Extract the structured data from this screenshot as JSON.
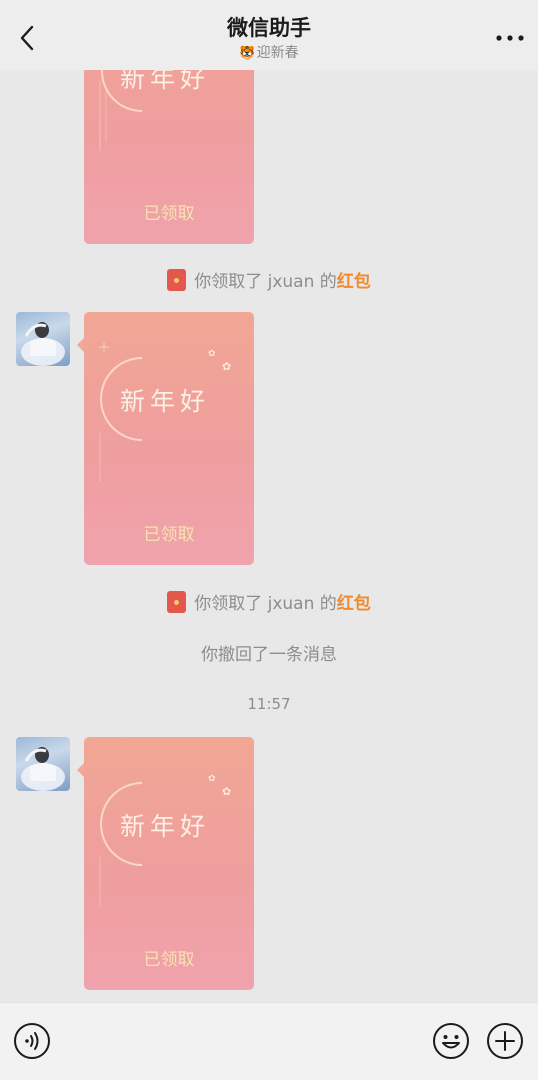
{
  "header": {
    "title": "微信助手",
    "subtitle_icon": "🐯",
    "subtitle": "迎新春"
  },
  "messages": [
    {
      "type": "red_packet",
      "greeting": "新年好",
      "status": "已领取",
      "partial": true
    },
    {
      "type": "system_red_packet",
      "prefix": "你领取了 jxuan 的",
      "highlight": "红包"
    },
    {
      "type": "red_packet",
      "greeting": "新年好",
      "status": "已领取"
    },
    {
      "type": "system_red_packet",
      "prefix": "你领取了 jxuan 的",
      "highlight": "红包"
    },
    {
      "type": "system_text",
      "text": "你撤回了一条消息"
    },
    {
      "type": "time",
      "text": "11:57"
    },
    {
      "type": "red_packet",
      "greeting": "新年好",
      "status": "已领取"
    }
  ],
  "input": {
    "placeholder": ""
  },
  "icons": {
    "back": "back-chevron-icon",
    "more": "more-dots-icon",
    "voice": "voice-icon",
    "emoji": "emoji-icon",
    "plus": "plus-icon"
  },
  "colors": {
    "highlight": "#f08a2c",
    "packet": "#f0a39a",
    "packet_status": "#f8e3b0",
    "red_packet_icon": "#e4574c"
  }
}
